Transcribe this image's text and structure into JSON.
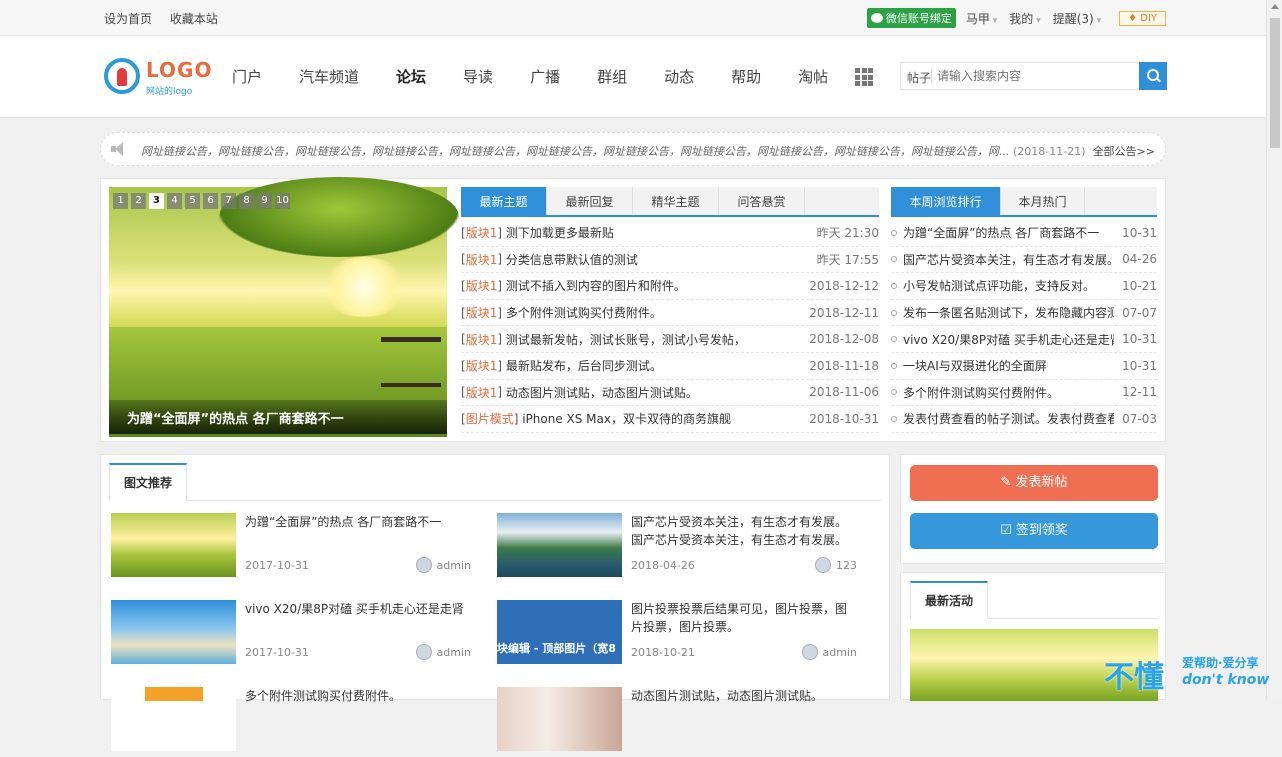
{
  "topbar": {
    "set_home": "设为首页",
    "bookmark": "收藏本站",
    "wechat_bind": "微信账号绑定",
    "user": "马甲",
    "mine": "我的",
    "remind": "提醒(3)",
    "diy": "♦ DIY"
  },
  "header": {
    "logo_text": "LOGO",
    "logo_sub": "网站的logo",
    "nav": [
      "门户",
      "汽车频道",
      "论坛",
      "导读",
      "广播",
      "群组",
      "动态",
      "帮助",
      "淘帖"
    ],
    "search_label": "帖子",
    "search_placeholder": "请输入搜索内容"
  },
  "notice": {
    "text": "网址链接公告，网址链接公告，网址链接公告，网址链接公告，网址链接公告，网址链接公告，网址链接公告，网址链接公告，网址链接公告，网址链接公告，网址链接公告，网...",
    "date": "(2018-11-21)",
    "all_link": "全部公告>>"
  },
  "slider": {
    "pages": [
      "1",
      "2",
      "3",
      "4",
      "5",
      "6",
      "7",
      "8",
      "9",
      "10"
    ],
    "active": "3",
    "caption": "为蹭“全面屏”的热点 各厂商套路不一"
  },
  "topics": {
    "tabs": [
      "最新主题",
      "最新回复",
      "精华主题",
      "问答悬赏"
    ],
    "rows": [
      {
        "tag": "版块1",
        "title": "测下加载更多最新贴",
        "date": "昨天 21:30"
      },
      {
        "tag": "版块1",
        "title": "分类信息带默认值的测试",
        "date": "昨天 17:55"
      },
      {
        "tag": "版块1",
        "title": "测试不插入到内容的图片和附件。",
        "date": "2018-12-12"
      },
      {
        "tag": "版块1",
        "title": "多个附件测试购买付费附件。",
        "date": "2018-12-11"
      },
      {
        "tag": "版块1",
        "title": "测试最新发帖，测试长账号，测试小号发帖，",
        "date": "2018-12-08"
      },
      {
        "tag": "版块1",
        "title": "最新贴发布，后台同步测试。",
        "date": "2018-11-18"
      },
      {
        "tag": "版块1",
        "title": "动态图片测试贴，动态图片测试贴。",
        "date": "2018-11-06"
      },
      {
        "tag": "图片模式",
        "title": "iPhone XS Max，双卡双待的商务旗舰",
        "date": "2018-10-31"
      }
    ]
  },
  "ranking": {
    "tabs": [
      "本周浏览排行",
      "本月热门"
    ],
    "rows": [
      {
        "title": "为蹭“全面屏”的热点 各厂商套路不一",
        "date": "10-31"
      },
      {
        "title": "国产芯片受资本关注，有生态才有发展。",
        "date": "04-26"
      },
      {
        "title": "小号发帖测试点评功能，支持反对。",
        "date": "10-21"
      },
      {
        "title": "发布一条匿名贴测试下，发布隐藏内容测",
        "date": "07-07"
      },
      {
        "title": "vivo X20/果8P对磕 买手机走心还是走肾",
        "date": "10-31"
      },
      {
        "title": "一块AI与双摄进化的全面屏",
        "date": "10-31"
      },
      {
        "title": "多个附件测试购买付费附件。",
        "date": "12-11"
      },
      {
        "title": "发表付费查看的帖子测试。发表付费查看",
        "date": "07-03"
      }
    ]
  },
  "recommend": {
    "tab": "图文推荐",
    "items": [
      {
        "title": "为蹭“全面屏”的热点 各厂商套路不一",
        "date": "2017-10-31",
        "author": "admin"
      },
      {
        "title": "国产芯片受资本关注，有生态才有发展。国产芯片受资本关注，有生态才有发展。",
        "date": "2018-04-26",
        "author": "123"
      },
      {
        "title": "vivo X20/果8P对磕 买手机走心还是走肾",
        "date": "2017-10-31",
        "author": "admin"
      },
      {
        "title": "图片投票投票后结果可见，图片投票，图片投票，图片投票。",
        "date": "2018-10-21",
        "author": "admin"
      },
      {
        "title": "多个附件测试购买付费附件。",
        "date": "",
        "author": ""
      },
      {
        "title": "动态图片测试贴，动态图片测试贴。",
        "date": "",
        "author": ""
      }
    ],
    "thumb_overlay": "块编辑 - 顶部图片（宽8"
  },
  "side": {
    "post_button": "发表新帖",
    "sign_button": "签到领奖",
    "activity_tab": "最新活动"
  },
  "watermark": {
    "big": "不懂",
    "line1": "爱帮助·爱分享",
    "line2": "don't know"
  }
}
